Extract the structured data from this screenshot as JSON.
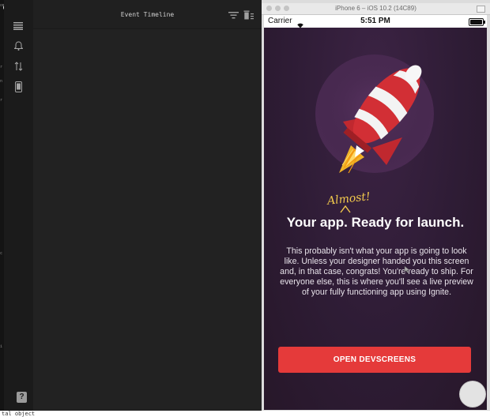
{
  "left_app": {
    "header_title": "Event Timeline",
    "edge_chars": [
      "om",
      "r",
      "n",
      "r",
      "c",
      "i"
    ],
    "sidebar_icons": [
      "menu-icon",
      "bell-icon",
      "sort-arrows-icon",
      "phone-icon"
    ],
    "header_icons": [
      "filter-icon",
      "trash-icon"
    ],
    "help_label": "?",
    "terminal_text": "tal object"
  },
  "simulator": {
    "title": "iPhone 6 – iOS 10.2 (14C89)",
    "status_bar": {
      "carrier": "Carrier",
      "time": "5:51 PM"
    },
    "screen": {
      "almost": "Almost!",
      "headline": "Your app. Ready for launch.",
      "body": "This probably isn't what your app is going to look like. Unless your designer handed you this screen and, in that case, congrats! You're ready to ship. For everyone else, this is where you'll see a live preview of your fully functioning app using Ignite.",
      "button_label": "OPEN DEVSCREENS"
    }
  },
  "colors": {
    "accent_red": "#e53a3a",
    "screen_bg": "#2e1c35",
    "almost_yellow": "#f2c94c"
  }
}
